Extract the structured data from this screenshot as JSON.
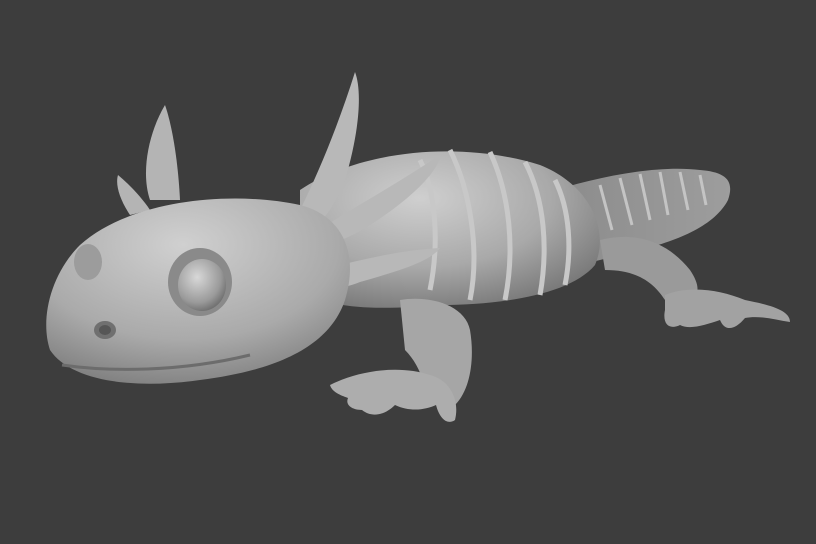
{
  "viewport": {
    "background_color": "#3d3d3d",
    "model_color": "#a8a8a8",
    "model_highlight": "#c9c9c9",
    "model_shadow": "#6e6e6e"
  },
  "model": {
    "subject": "axolotl",
    "material": "clay"
  }
}
